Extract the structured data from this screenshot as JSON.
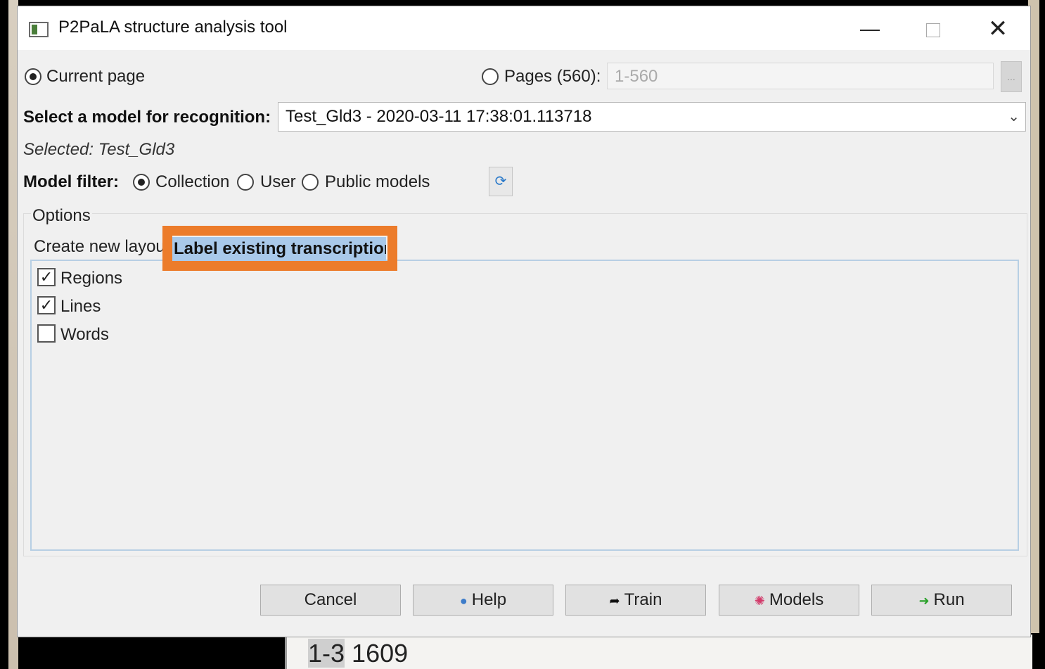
{
  "background": {
    "bottom_highlight": "1-3",
    "bottom_text": "1609"
  },
  "window": {
    "title": "P2PaLA structure analysis tool",
    "minimize": "—",
    "close": "✕"
  },
  "scope": {
    "current_page": "Current page",
    "pages_label": "Pages (560):",
    "pages_value": "1-560",
    "pages_button": "..."
  },
  "model": {
    "select_label": "Select a model for recognition:",
    "selected_value": "Test_Gld3 - 2020-03-11 17:38:01.113718",
    "selected_info": "Selected: Test_Gld3"
  },
  "filter": {
    "label": "Model filter:",
    "options": [
      "Collection",
      "User",
      "Public models"
    ],
    "selected": "Collection"
  },
  "options": {
    "group_label": "Options",
    "tabs": [
      "Create new layout",
      "Label existing transcription"
    ],
    "active_tab": "Label existing transcription",
    "checkboxes": [
      {
        "label": "Regions",
        "checked": true
      },
      {
        "label": "Lines",
        "checked": true
      },
      {
        "label": "Words",
        "checked": false
      }
    ]
  },
  "buttons": {
    "cancel": "Cancel",
    "help": "Help",
    "train": "Train",
    "models": "Models",
    "run": "Run"
  },
  "colors": {
    "highlight": "#ec7c2b",
    "selected_tab": "#a9c9ea"
  }
}
